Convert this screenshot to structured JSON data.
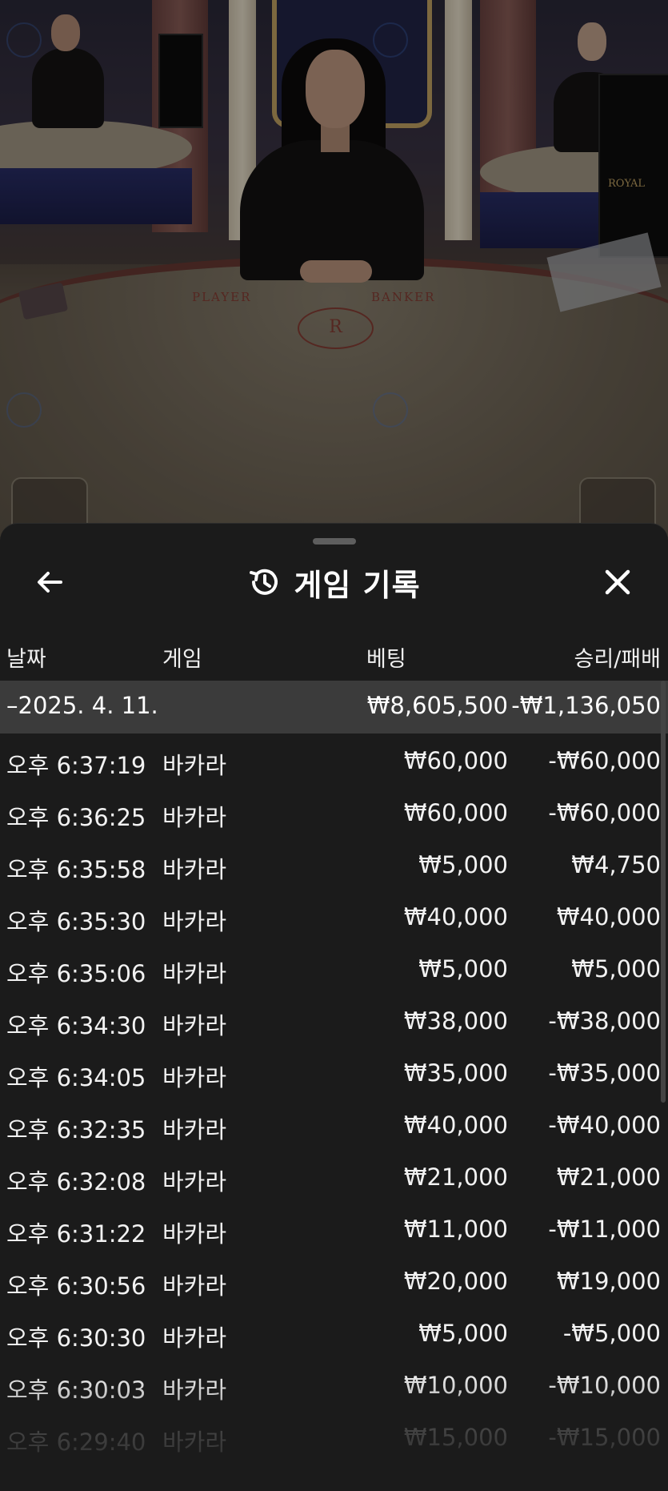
{
  "stream": {
    "table_player_label": "PLAYER",
    "table_banker_label": "BANKER",
    "logo_letter": "R",
    "screen_brand": "ROYAL"
  },
  "sheet": {
    "title": "게임 기록",
    "icons": {
      "back": "arrow-left-icon",
      "history": "history-clock-icon",
      "close": "close-icon"
    },
    "columns": {
      "date": "날짜",
      "game": "게임",
      "bet": "베팅",
      "result": "승리/패배"
    },
    "summary": {
      "date": "–2025. 4. 11.",
      "bet": "₩8,605,500",
      "result": "-₩1,136,050"
    },
    "rows": [
      {
        "time": "오후 6:37:19",
        "game": "바카라",
        "bet": "₩60,000",
        "result": "-₩60,000"
      },
      {
        "time": "오후 6:36:25",
        "game": "바카라",
        "bet": "₩60,000",
        "result": "-₩60,000"
      },
      {
        "time": "오후 6:35:58",
        "game": "바카라",
        "bet": "₩5,000",
        "result": "₩4,750"
      },
      {
        "time": "오후 6:35:30",
        "game": "바카라",
        "bet": "₩40,000",
        "result": "₩40,000"
      },
      {
        "time": "오후 6:35:06",
        "game": "바카라",
        "bet": "₩5,000",
        "result": "₩5,000"
      },
      {
        "time": "오후 6:34:30",
        "game": "바카라",
        "bet": "₩38,000",
        "result": "-₩38,000"
      },
      {
        "time": "오후 6:34:05",
        "game": "바카라",
        "bet": "₩35,000",
        "result": "-₩35,000"
      },
      {
        "time": "오후 6:32:35",
        "game": "바카라",
        "bet": "₩40,000",
        "result": "-₩40,000"
      },
      {
        "time": "오후 6:32:08",
        "game": "바카라",
        "bet": "₩21,000",
        "result": "₩21,000"
      },
      {
        "time": "오후 6:31:22",
        "game": "바카라",
        "bet": "₩11,000",
        "result": "-₩11,000"
      },
      {
        "time": "오후 6:30:56",
        "game": "바카라",
        "bet": "₩20,000",
        "result": "₩19,000"
      },
      {
        "time": "오후 6:30:30",
        "game": "바카라",
        "bet": "₩5,000",
        "result": "-₩5,000"
      },
      {
        "time": "오후 6:30:03",
        "game": "바카라",
        "bet": "₩10,000",
        "result": "-₩10,000"
      },
      {
        "time": "오후 6:29:40",
        "game": "바카라",
        "bet": "₩15,000",
        "result": "-₩15,000"
      }
    ]
  },
  "colors": {
    "sheet_bg": "#1b1b1b",
    "summary_bg": "#3b3b3b",
    "text": "#ffffff"
  }
}
